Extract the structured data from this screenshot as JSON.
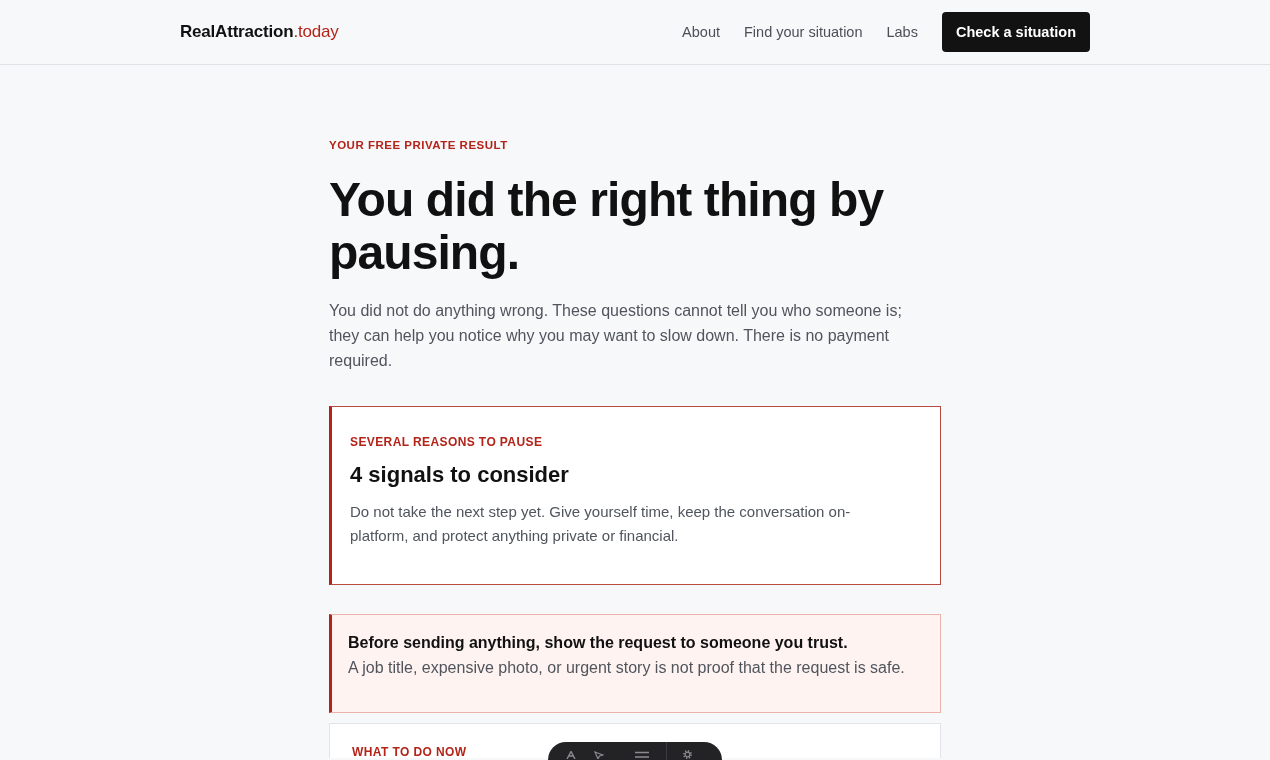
{
  "header": {
    "logo": {
      "name": "RealAttraction",
      "suffix": ".today"
    },
    "nav": [
      {
        "label": "About"
      },
      {
        "label": "Find your situation"
      },
      {
        "label": "Labs"
      }
    ],
    "cta": "Check a situation"
  },
  "hero": {
    "eyebrow": "YOUR FREE PRIVATE RESULT",
    "title": "You did the right thing by pausing.",
    "intro": "You did not do anything wrong. These questions cannot tell you who someone is; they can help you notice why you may want to slow down. There is no payment required."
  },
  "cards": [
    {
      "kind": "result",
      "eyebrow": "SEVERAL REASONS TO PAUSE",
      "title": "4 signals to consider",
      "body": "Do not take the next step yet. Give yourself time, keep the conversation on-platform, and protect anything private or financial."
    },
    {
      "kind": "alert",
      "title": "Before sending anything, show the request to someone you trust.",
      "body": "A job title, expensive photo, or urgent story is not proof that the request is safe."
    },
    {
      "kind": "section",
      "eyebrow": "WHAT TO DO NOW"
    }
  ]
}
